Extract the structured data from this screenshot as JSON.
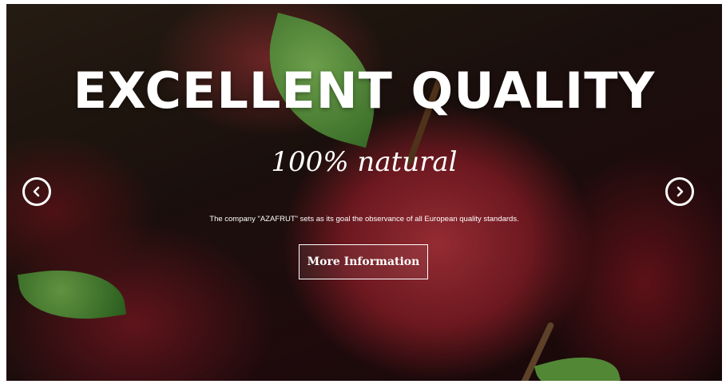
{
  "slider": {
    "title": "EXCELLENT QUALITY",
    "subtitle": "100% natural",
    "description": "The company \"AZAFRUT\" sets as its goal the observance of all European quality standards.",
    "button_label": "More Information"
  },
  "icons": {
    "prev": "chevron-left-icon",
    "next": "chevron-right-icon"
  },
  "colors": {
    "text": "#ffffff",
    "apple_red": "#a9323a",
    "leaf_green": "#4f8a3a"
  }
}
